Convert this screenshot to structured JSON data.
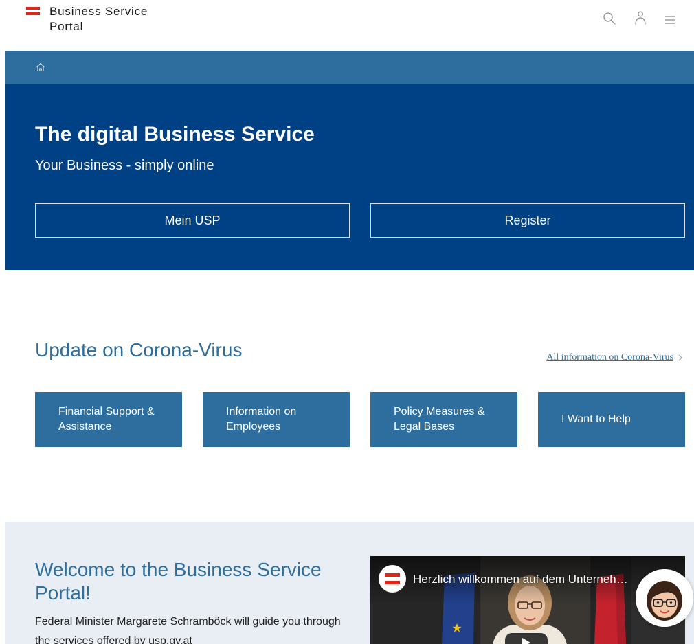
{
  "header": {
    "logo": {
      "mark_icon": "austria-flag-logo",
      "line1": "Business Service",
      "line2": "Portal"
    },
    "action_icons": [
      "search-icon",
      "user-icon",
      "menu-icon"
    ]
  },
  "breadcrumb": {
    "items": [
      "home-icon"
    ]
  },
  "hero": {
    "title": "The digital Business Service",
    "subtitle": "Your Business - simply online",
    "buttons": [
      {
        "label": "Mein USP"
      },
      {
        "label": "Register"
      }
    ]
  },
  "corona": {
    "heading": "Update on Corona-Virus",
    "link": {
      "label": "All information on Corona-Virus",
      "icon": "chevron-right-icon"
    },
    "tiles": [
      {
        "label": "Financial Support & Assistance"
      },
      {
        "label": "Information on Employees"
      },
      {
        "label": "Policy Measures & Legal Bases"
      },
      {
        "label": "I Want to Help"
      }
    ]
  },
  "welcome": {
    "heading": "Welcome to the Business Service Portal!",
    "text": "Federal Minister Margarete Schramböck will guide you through the services offered by usp.gv.at",
    "video": {
      "channel_icon": "austria-flag-logo",
      "title": "Herzlich willkommen auf dem Unterneh…",
      "play_icon": "play-icon"
    }
  },
  "chat_widget": {
    "icon": "assistant-avatar-icon"
  },
  "colors": {
    "brand_red": "#e2231a",
    "primary_dark": "#004185",
    "primary": "#2e6e9e",
    "section_bg": "#e8eef4"
  }
}
